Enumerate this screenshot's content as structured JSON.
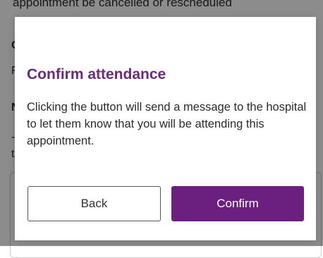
{
  "background": {
    "top_line": "appointment be cancelled or rescheduled",
    "fragments": [
      "C",
      "F",
      "N",
      "-",
      "t"
    ]
  },
  "modal": {
    "title": "Confirm attendance",
    "body": "Clicking the button will send a message to the hospital to let them know that you will be attending this appointment.",
    "back_label": "Back",
    "confirm_label": "Confirm"
  },
  "colors": {
    "accent": "#6b1f7f",
    "title": "#6b2a7c",
    "overlay": "rgba(0,0,0,0.45)"
  }
}
